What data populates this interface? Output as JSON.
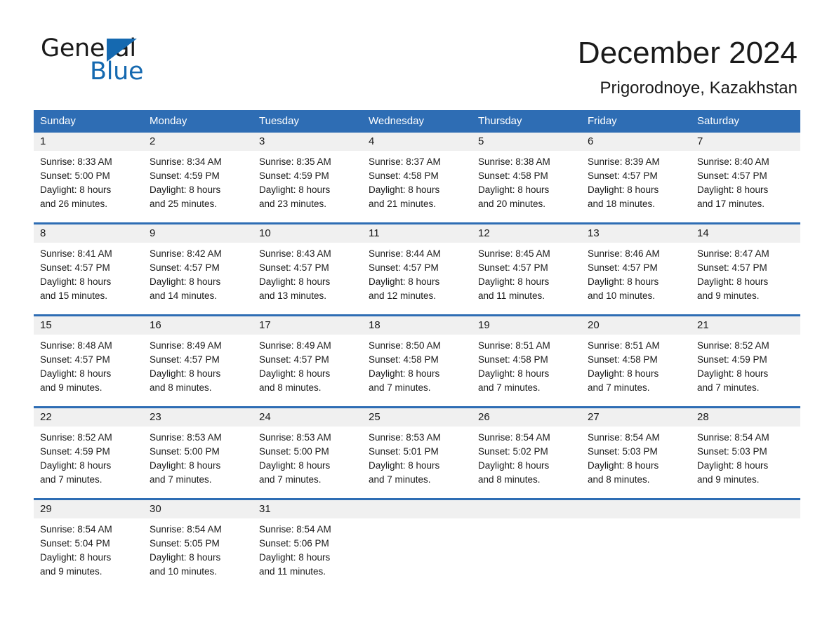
{
  "brand": {
    "name_part1": "General",
    "name_part2": "Blue",
    "accent_color": "#1569b0"
  },
  "header": {
    "month_title": "December 2024",
    "location": "Prigorodnoye, Kazakhstan"
  },
  "calendar": {
    "header_bg": "#2e6db4",
    "daynum_bg": "#f0f0f0",
    "weekday_headers": [
      "Sunday",
      "Monday",
      "Tuesday",
      "Wednesday",
      "Thursday",
      "Friday",
      "Saturday"
    ],
    "weeks": [
      [
        {
          "day": "1",
          "sunrise": "Sunrise: 8:33 AM",
          "sunset": "Sunset: 5:00 PM",
          "daylight_line1": "Daylight: 8 hours",
          "daylight_line2": "and 26 minutes."
        },
        {
          "day": "2",
          "sunrise": "Sunrise: 8:34 AM",
          "sunset": "Sunset: 4:59 PM",
          "daylight_line1": "Daylight: 8 hours",
          "daylight_line2": "and 25 minutes."
        },
        {
          "day": "3",
          "sunrise": "Sunrise: 8:35 AM",
          "sunset": "Sunset: 4:59 PM",
          "daylight_line1": "Daylight: 8 hours",
          "daylight_line2": "and 23 minutes."
        },
        {
          "day": "4",
          "sunrise": "Sunrise: 8:37 AM",
          "sunset": "Sunset: 4:58 PM",
          "daylight_line1": "Daylight: 8 hours",
          "daylight_line2": "and 21 minutes."
        },
        {
          "day": "5",
          "sunrise": "Sunrise: 8:38 AM",
          "sunset": "Sunset: 4:58 PM",
          "daylight_line1": "Daylight: 8 hours",
          "daylight_line2": "and 20 minutes."
        },
        {
          "day": "6",
          "sunrise": "Sunrise: 8:39 AM",
          "sunset": "Sunset: 4:57 PM",
          "daylight_line1": "Daylight: 8 hours",
          "daylight_line2": "and 18 minutes."
        },
        {
          "day": "7",
          "sunrise": "Sunrise: 8:40 AM",
          "sunset": "Sunset: 4:57 PM",
          "daylight_line1": "Daylight: 8 hours",
          "daylight_line2": "and 17 minutes."
        }
      ],
      [
        {
          "day": "8",
          "sunrise": "Sunrise: 8:41 AM",
          "sunset": "Sunset: 4:57 PM",
          "daylight_line1": "Daylight: 8 hours",
          "daylight_line2": "and 15 minutes."
        },
        {
          "day": "9",
          "sunrise": "Sunrise: 8:42 AM",
          "sunset": "Sunset: 4:57 PM",
          "daylight_line1": "Daylight: 8 hours",
          "daylight_line2": "and 14 minutes."
        },
        {
          "day": "10",
          "sunrise": "Sunrise: 8:43 AM",
          "sunset": "Sunset: 4:57 PM",
          "daylight_line1": "Daylight: 8 hours",
          "daylight_line2": "and 13 minutes."
        },
        {
          "day": "11",
          "sunrise": "Sunrise: 8:44 AM",
          "sunset": "Sunset: 4:57 PM",
          "daylight_line1": "Daylight: 8 hours",
          "daylight_line2": "and 12 minutes."
        },
        {
          "day": "12",
          "sunrise": "Sunrise: 8:45 AM",
          "sunset": "Sunset: 4:57 PM",
          "daylight_line1": "Daylight: 8 hours",
          "daylight_line2": "and 11 minutes."
        },
        {
          "day": "13",
          "sunrise": "Sunrise: 8:46 AM",
          "sunset": "Sunset: 4:57 PM",
          "daylight_line1": "Daylight: 8 hours",
          "daylight_line2": "and 10 minutes."
        },
        {
          "day": "14",
          "sunrise": "Sunrise: 8:47 AM",
          "sunset": "Sunset: 4:57 PM",
          "daylight_line1": "Daylight: 8 hours",
          "daylight_line2": "and 9 minutes."
        }
      ],
      [
        {
          "day": "15",
          "sunrise": "Sunrise: 8:48 AM",
          "sunset": "Sunset: 4:57 PM",
          "daylight_line1": "Daylight: 8 hours",
          "daylight_line2": "and 9 minutes."
        },
        {
          "day": "16",
          "sunrise": "Sunrise: 8:49 AM",
          "sunset": "Sunset: 4:57 PM",
          "daylight_line1": "Daylight: 8 hours",
          "daylight_line2": "and 8 minutes."
        },
        {
          "day": "17",
          "sunrise": "Sunrise: 8:49 AM",
          "sunset": "Sunset: 4:57 PM",
          "daylight_line1": "Daylight: 8 hours",
          "daylight_line2": "and 8 minutes."
        },
        {
          "day": "18",
          "sunrise": "Sunrise: 8:50 AM",
          "sunset": "Sunset: 4:58 PM",
          "daylight_line1": "Daylight: 8 hours",
          "daylight_line2": "and 7 minutes."
        },
        {
          "day": "19",
          "sunrise": "Sunrise: 8:51 AM",
          "sunset": "Sunset: 4:58 PM",
          "daylight_line1": "Daylight: 8 hours",
          "daylight_line2": "and 7 minutes."
        },
        {
          "day": "20",
          "sunrise": "Sunrise: 8:51 AM",
          "sunset": "Sunset: 4:58 PM",
          "daylight_line1": "Daylight: 8 hours",
          "daylight_line2": "and 7 minutes."
        },
        {
          "day": "21",
          "sunrise": "Sunrise: 8:52 AM",
          "sunset": "Sunset: 4:59 PM",
          "daylight_line1": "Daylight: 8 hours",
          "daylight_line2": "and 7 minutes."
        }
      ],
      [
        {
          "day": "22",
          "sunrise": "Sunrise: 8:52 AM",
          "sunset": "Sunset: 4:59 PM",
          "daylight_line1": "Daylight: 8 hours",
          "daylight_line2": "and 7 minutes."
        },
        {
          "day": "23",
          "sunrise": "Sunrise: 8:53 AM",
          "sunset": "Sunset: 5:00 PM",
          "daylight_line1": "Daylight: 8 hours",
          "daylight_line2": "and 7 minutes."
        },
        {
          "day": "24",
          "sunrise": "Sunrise: 8:53 AM",
          "sunset": "Sunset: 5:00 PM",
          "daylight_line1": "Daylight: 8 hours",
          "daylight_line2": "and 7 minutes."
        },
        {
          "day": "25",
          "sunrise": "Sunrise: 8:53 AM",
          "sunset": "Sunset: 5:01 PM",
          "daylight_line1": "Daylight: 8 hours",
          "daylight_line2": "and 7 minutes."
        },
        {
          "day": "26",
          "sunrise": "Sunrise: 8:54 AM",
          "sunset": "Sunset: 5:02 PM",
          "daylight_line1": "Daylight: 8 hours",
          "daylight_line2": "and 8 minutes."
        },
        {
          "day": "27",
          "sunrise": "Sunrise: 8:54 AM",
          "sunset": "Sunset: 5:03 PM",
          "daylight_line1": "Daylight: 8 hours",
          "daylight_line2": "and 8 minutes."
        },
        {
          "day": "28",
          "sunrise": "Sunrise: 8:54 AM",
          "sunset": "Sunset: 5:03 PM",
          "daylight_line1": "Daylight: 8 hours",
          "daylight_line2": "and 9 minutes."
        }
      ],
      [
        {
          "day": "29",
          "sunrise": "Sunrise: 8:54 AM",
          "sunset": "Sunset: 5:04 PM",
          "daylight_line1": "Daylight: 8 hours",
          "daylight_line2": "and 9 minutes."
        },
        {
          "day": "30",
          "sunrise": "Sunrise: 8:54 AM",
          "sunset": "Sunset: 5:05 PM",
          "daylight_line1": "Daylight: 8 hours",
          "daylight_line2": "and 10 minutes."
        },
        {
          "day": "31",
          "sunrise": "Sunrise: 8:54 AM",
          "sunset": "Sunset: 5:06 PM",
          "daylight_line1": "Daylight: 8 hours",
          "daylight_line2": "and 11 minutes."
        },
        {
          "day": "",
          "sunrise": "",
          "sunset": "",
          "daylight_line1": "",
          "daylight_line2": ""
        },
        {
          "day": "",
          "sunrise": "",
          "sunset": "",
          "daylight_line1": "",
          "daylight_line2": ""
        },
        {
          "day": "",
          "sunrise": "",
          "sunset": "",
          "daylight_line1": "",
          "daylight_line2": ""
        },
        {
          "day": "",
          "sunrise": "",
          "sunset": "",
          "daylight_line1": "",
          "daylight_line2": ""
        }
      ]
    ]
  }
}
